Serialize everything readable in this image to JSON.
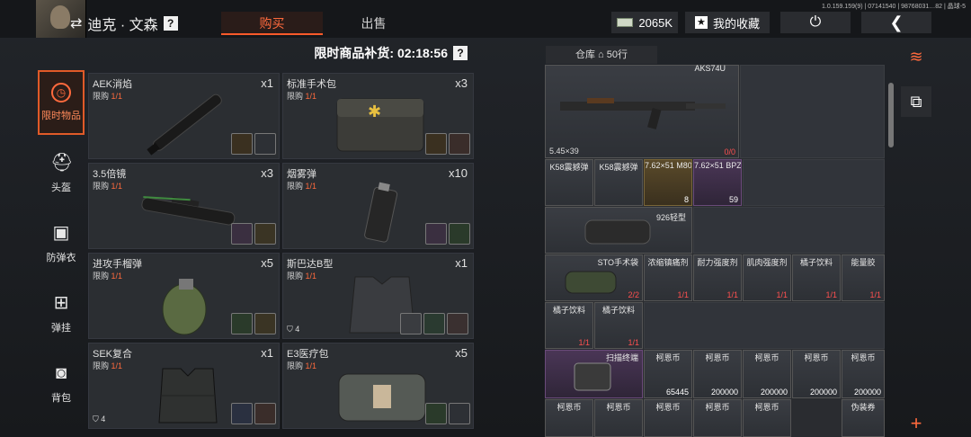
{
  "player": {
    "name": "迪克 · 文森",
    "help": "?"
  },
  "tabs": {
    "buy": "购买",
    "sell": "出售"
  },
  "money": "2065K",
  "favorites": "我的收藏",
  "version": "1.0.159.159(9) | 07141540 | 98768031…82 | 晶球-5",
  "categories": [
    {
      "label": "限时物品",
      "icon": "clock-icon"
    },
    {
      "label": "头盔",
      "icon": "helmet-icon"
    },
    {
      "label": "防弹衣",
      "icon": "vest-icon"
    },
    {
      "label": "弹挂",
      "icon": "rig-icon"
    },
    {
      "label": "背包",
      "icon": "backpack-icon"
    }
  ],
  "shop": {
    "restock_label": "限时商品补货: 02:18:56",
    "limit_prefix": "限购",
    "items": [
      {
        "name": "AEK消焰",
        "qty": "x1",
        "limit": "1/1"
      },
      {
        "name": "标准手术包",
        "qty": "x3",
        "limit": "1/1"
      },
      {
        "name": "3.5倍镜",
        "qty": "x3",
        "limit": "1/1"
      },
      {
        "name": "烟雾弹",
        "qty": "x10",
        "limit": "1/1"
      },
      {
        "name": "进攻手榴弹",
        "qty": "x5",
        "limit": "1/1"
      },
      {
        "name": "斯巴达B型",
        "qty": "x1",
        "limit": "1/1",
        "armor": "4"
      },
      {
        "name": "SEK复合",
        "qty": "x1",
        "limit": "1/1",
        "armor": "4"
      },
      {
        "name": "E3医疗包",
        "qty": "x5",
        "limit": "1/1"
      }
    ]
  },
  "warehouse": {
    "title": "仓库",
    "rows": "50行",
    "items": {
      "gun": {
        "name": "AKS74U",
        "caliber": "5.45×39",
        "ammo": "0/0"
      },
      "k58a": {
        "name": "K58震撼弹"
      },
      "k58b": {
        "name": "K58震撼弹"
      },
      "m80": {
        "name": "7.62×51 M80",
        "count": "8"
      },
      "bpz": {
        "name": "7.62×51 BPZ",
        "count": "59"
      },
      "glove": {
        "name": "926轻型"
      },
      "sto": {
        "name": "STO手术袋",
        "count": "2/2"
      },
      "c1": {
        "name": "浓缩镇痛剂",
        "count": "1/1"
      },
      "c2": {
        "name": "耐力强度剂",
        "count": "1/1"
      },
      "c3": {
        "name": "肌肉强度剂",
        "count": "1/1"
      },
      "c4": {
        "name": "橘子饮料",
        "count": "1/1"
      },
      "c5": {
        "name": "能量胶",
        "count": "1/1"
      },
      "d1": {
        "name": "橘子饮料",
        "count": "1/1"
      },
      "d2": {
        "name": "橘子饮料",
        "count": "1/1"
      },
      "scanner": {
        "name": "扫描终端"
      },
      "coins": [
        {
          "name": "柯恩币",
          "count": "65445"
        },
        {
          "name": "柯恩币",
          "count": "200000"
        },
        {
          "name": "柯恩币",
          "count": "200000"
        },
        {
          "name": "柯恩币",
          "count": "200000"
        },
        {
          "name": "柯恩币",
          "count": "200000"
        }
      ],
      "coins2": [
        {
          "name": "柯恩币"
        },
        {
          "name": "柯恩币"
        },
        {
          "name": "柯恩币"
        },
        {
          "name": "柯恩币"
        },
        {
          "name": "柯恩币"
        }
      ],
      "fake": {
        "name": "伪装券"
      }
    }
  },
  "colors": {
    "accent": "#ff6a3d",
    "limit": "#ff6a3d",
    "purple": "#4a3656",
    "gold": "#5a4a2a"
  }
}
